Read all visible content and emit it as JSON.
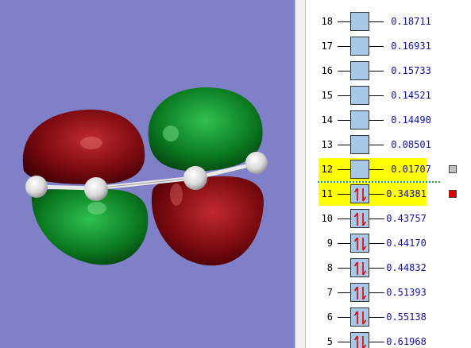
{
  "orbitals": [
    {
      "n": "18",
      "energy": "0.18711",
      "occupied": false
    },
    {
      "n": "17",
      "energy": "0.16931",
      "occupied": false
    },
    {
      "n": "16",
      "energy": "0.15733",
      "occupied": false
    },
    {
      "n": "15",
      "energy": "0.14521",
      "occupied": false
    },
    {
      "n": "14",
      "energy": "0.14490",
      "occupied": false
    },
    {
      "n": "13",
      "energy": "0.08501",
      "occupied": false
    },
    {
      "n": "12",
      "energy": "0.01707",
      "occupied": false,
      "highlight": true,
      "marker": "#c0c0c0"
    },
    {
      "n": "11",
      "energy": "-0.34381",
      "occupied": true,
      "highlight": true,
      "marker": "#e00000"
    },
    {
      "n": "10",
      "energy": "-0.43757",
      "occupied": true
    },
    {
      "n": "9",
      "energy": "-0.44170",
      "occupied": true
    },
    {
      "n": "8",
      "energy": "-0.44832",
      "occupied": true
    },
    {
      "n": "7",
      "energy": "-0.51393",
      "occupied": true
    },
    {
      "n": "6",
      "energy": "-0.55138",
      "occupied": true
    },
    {
      "n": "5",
      "energy": "-0.61968",
      "occupied": true
    }
  ],
  "colors": {
    "background": "#8080c8",
    "lobe_red": "#8a0c14",
    "lobe_green": "#0e8a24",
    "highlight": "#ffff00",
    "box_fill": "#a8c8e8",
    "energy_text": "#1010a0",
    "arrow": "#e00000"
  }
}
